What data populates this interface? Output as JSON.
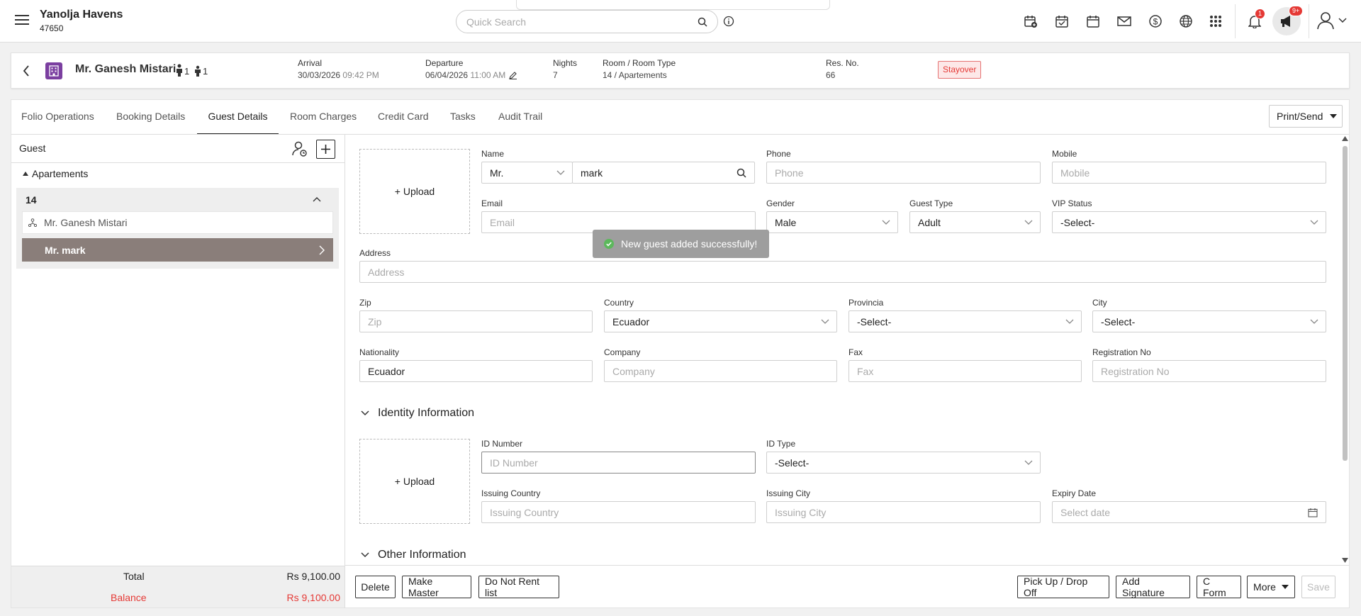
{
  "app": {
    "hotel_name": "Yanolja Havens",
    "hotel_id": "47650"
  },
  "search": {
    "placeholder": "Quick Search"
  },
  "header_icons": [
    "calendar-add-icon",
    "calendar-check-icon",
    "calendar-icon",
    "mail-icon",
    "dollar-icon",
    "globe-icon",
    "apps-grid-icon"
  ],
  "notifications": {
    "count": "1"
  },
  "announcements": {
    "count": "9+"
  },
  "guest_header": {
    "name": "Mr. Ganesh Mistari",
    "adults": "1",
    "children": "1",
    "arrival_label": "Arrival",
    "arrival_date": "30/03/2026",
    "arrival_time": "09:42 PM",
    "departure_label": "Departure",
    "departure_date": "06/04/2026",
    "departure_time": "11:00 AM",
    "nights_label": "Nights",
    "nights": "7",
    "room_label": "Room / Room Type",
    "room_value": "14 / Apartements",
    "res_label": "Res. No.",
    "res_no": "66",
    "status": "Stayover"
  },
  "tabs": [
    "Folio Operations",
    "Booking Details",
    "Guest Details",
    "Room Charges",
    "Credit Card",
    "Tasks",
    "Audit Trail"
  ],
  "active_tab": "Guest Details",
  "print_send": "Print/Send",
  "sidebar": {
    "title": "Guest",
    "group": "Apartements",
    "room": "14",
    "guests": [
      "Mr. Ganesh Mistari",
      "Mr. mark"
    ],
    "total_label": "Total",
    "total_value": "Rs 9,100.00",
    "balance_label": "Balance",
    "balance_value": "Rs 9,100.00"
  },
  "form": {
    "upload_label": "+ Upload",
    "name_label": "Name",
    "salutation": "Mr.",
    "name_value": "mark",
    "phone_label": "Phone",
    "phone_placeholder": "Phone",
    "mobile_label": "Mobile",
    "mobile_placeholder": "Mobile",
    "email_label": "Email",
    "email_placeholder": "Email",
    "gender_label": "Gender",
    "gender_value": "Male",
    "guest_type_label": "Guest Type",
    "guest_type_value": "Adult",
    "vip_label": "VIP Status",
    "vip_value": "-Select-",
    "address_label": "Address",
    "address_placeholder": "Address",
    "zip_label": "Zip",
    "zip_placeholder": "Zip",
    "country_label": "Country",
    "country_value": "Ecuador",
    "provincia_label": "Provincia",
    "provincia_value": "-Select-",
    "city_label": "City",
    "city_value": "-Select-",
    "nationality_label": "Nationality",
    "nationality_value": "Ecuador",
    "company_label": "Company",
    "company_placeholder": "Company",
    "fax_label": "Fax",
    "fax_placeholder": "Fax",
    "registration_label": "Registration No",
    "registration_placeholder": "Registration No"
  },
  "identity": {
    "section_title": "Identity Information",
    "upload_label": "+ Upload",
    "id_number_label": "ID Number",
    "id_number_placeholder": "ID Number",
    "id_type_label": "ID Type",
    "id_type_value": "-Select-",
    "issuing_country_label": "Issuing Country",
    "issuing_country_placeholder": "Issuing Country",
    "issuing_city_label": "Issuing City",
    "issuing_city_placeholder": "Issuing City",
    "expiry_label": "Expiry Date",
    "expiry_placeholder": "Select date"
  },
  "other": {
    "section_title": "Other Information"
  },
  "toast": {
    "message": "New guest added successfully!"
  },
  "footer_buttons": {
    "delete": "Delete",
    "make_master": "Make Master",
    "do_not_rent": "Do Not Rent list",
    "pickup": "Pick Up / Drop Off",
    "signature": "Add Signature",
    "cform": "C Form",
    "more": "More",
    "save": "Save"
  },
  "colors": {
    "accent": "#222222",
    "status_bg": "#fde8e8",
    "status_text": "#e53935",
    "selected_guest_bg": "#8a7e7a",
    "toast_bg": "#9e9e9e",
    "balance": "#e53935"
  }
}
